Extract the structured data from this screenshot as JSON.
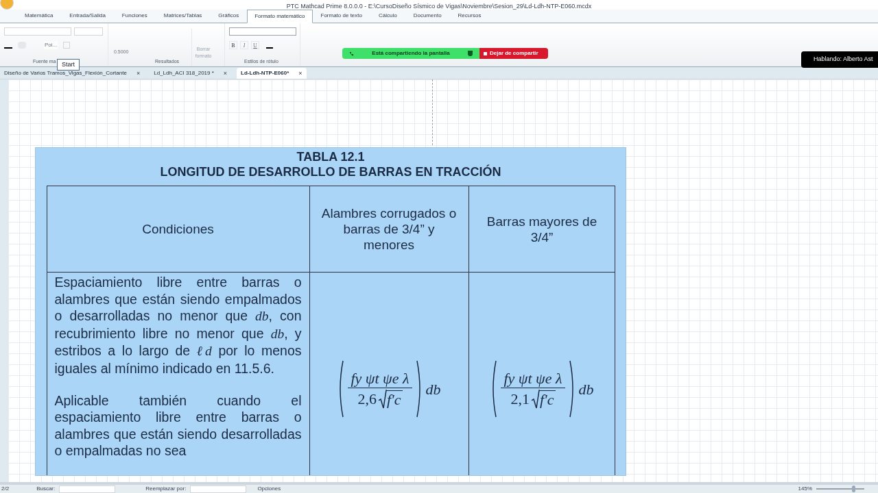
{
  "window": {
    "title": "PTC Mathcad Prime 8.0.0.0 - E:\\CursoDiseño Sísmico de Vigas\\Noviembre\\Sesion_29\\Ld-Ldh-NTP-E060.mcdx"
  },
  "ribbon_tabs": [
    {
      "label": "Matemática",
      "selected": false
    },
    {
      "label": "Entrada/Salida",
      "selected": false
    },
    {
      "label": "Funciones",
      "selected": false
    },
    {
      "label": "Matrices/Tablas",
      "selected": false
    },
    {
      "label": "Gráficos",
      "selected": false
    },
    {
      "label": "Formato matemático",
      "selected": true
    },
    {
      "label": "Formato de texto",
      "selected": false
    },
    {
      "label": "Cálculo",
      "selected": false
    },
    {
      "label": "Documento",
      "selected": false
    },
    {
      "label": "Recursos",
      "selected": false
    }
  ],
  "ribbon": {
    "font_group": {
      "label": "Fuente ma",
      "style_button": "Poi...",
      "tooltip": "Start"
    },
    "results_group": {
      "label": "Resultados",
      "value": "0.5000",
      "clear_button": "Borrar formato"
    },
    "label_styles_group": {
      "label": "Estilos de rótulo",
      "format_buttons": [
        "B",
        "I",
        "U"
      ]
    }
  },
  "screen_share": {
    "status": "Está compartiendo la pantalla",
    "stop_button": "Dejar de compartir",
    "speaker": "Hablando: Alberto Ast"
  },
  "document_tabs": [
    {
      "label": "Diseño de Varios Tramos_Vigas_Flexión_Cortante",
      "close": "×",
      "selected": false
    },
    {
      "label": "Ld_Ldh_ACI 318_2019 *",
      "close": "×",
      "selected": false
    },
    {
      "label": "Ld-Ldh-NTP-E060*",
      "close": "×",
      "selected": true
    }
  ],
  "table_image": {
    "title": "TABLA 12.1",
    "subtitle": "LONGITUD DE DESARROLLO DE BARRAS EN TRACCIÓN",
    "columns": [
      "Condiciones",
      "Alambres corrugados o barras de 3/4” y menores",
      "Barras mayores de 3/4”"
    ],
    "condition_paragraphs": [
      "Espaciamiento libre entre barras o alambres que están siendo empalmados o desarrolladas no menor que *db*, con recubrimiento libre no menor que *db*, y estribos a lo largo de *ℓd* por lo menos iguales al mínimo indicado en 11.5.6.",
      "Aplicable también cuando el espaciamiento libre entre barras o alambres que están siendo desarrolladas o empalmadas no sea"
    ],
    "formulas": [
      {
        "numerator": "fy ψt ψe λ",
        "coefficient": "2,6",
        "radicand": "f′c",
        "factor": "db"
      },
      {
        "numerator": "fy ψt ψe λ",
        "coefficient": "2,1",
        "radicand": "f′c",
        "factor": "db"
      }
    ]
  },
  "status_bar": {
    "page": "2/2",
    "find_label": "Buscar:",
    "replace_label": "Reemplazar por:",
    "options": "Opciones",
    "zoom": "145%",
    "zoom_slider": {
      "level": 0.8
    }
  }
}
